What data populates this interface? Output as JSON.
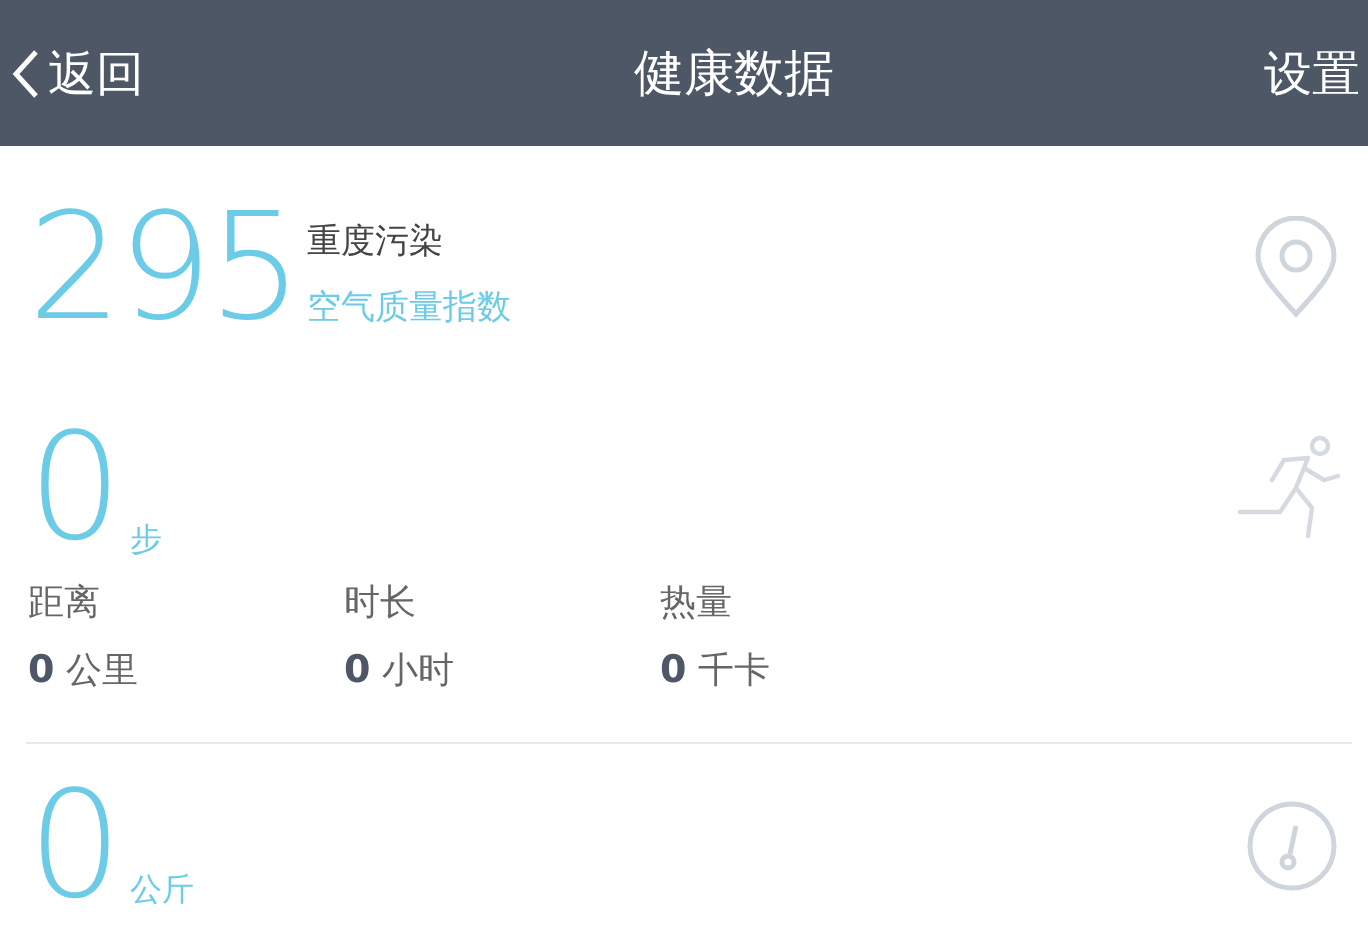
{
  "nav": {
    "back": "返回",
    "title": "健康数据",
    "settings": "设置"
  },
  "air_quality": {
    "value": "295",
    "status": "重度污染",
    "label": "空气质量指数"
  },
  "steps": {
    "value": "0",
    "unit": "步",
    "stats": [
      {
        "label": "距离",
        "value": "0",
        "unit": "公里"
      },
      {
        "label": "时长",
        "value": "0",
        "unit": "小时"
      },
      {
        "label": "热量",
        "value": "0",
        "unit": "千卡"
      }
    ]
  },
  "weight": {
    "value": "0",
    "unit": "公斤"
  }
}
